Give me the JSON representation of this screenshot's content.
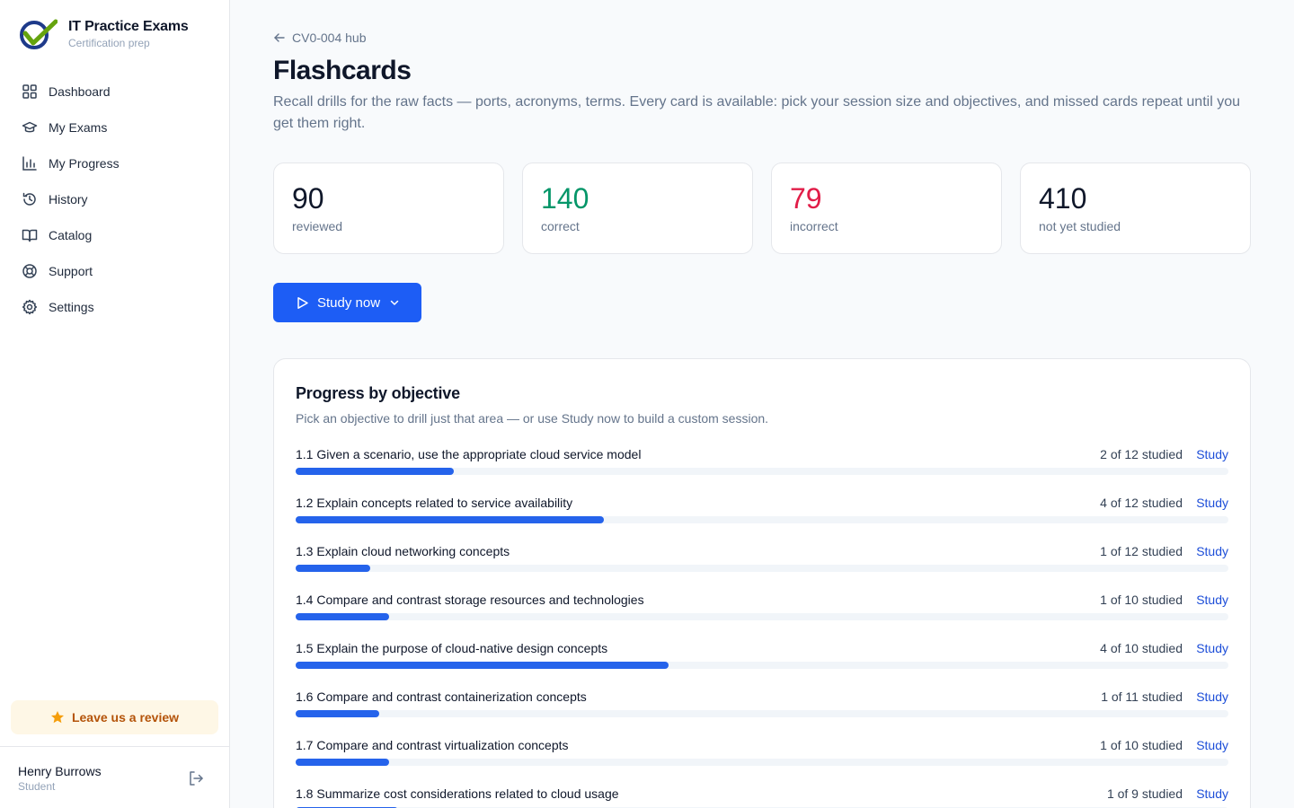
{
  "brand": {
    "title": "IT Practice Exams",
    "subtitle": "Certification prep"
  },
  "nav": [
    {
      "label": "Dashboard",
      "icon": "grid-icon"
    },
    {
      "label": "My Exams",
      "icon": "graduation-cap-icon"
    },
    {
      "label": "My Progress",
      "icon": "bar-chart-icon"
    },
    {
      "label": "History",
      "icon": "history-icon"
    },
    {
      "label": "Catalog",
      "icon": "book-open-icon"
    },
    {
      "label": "Support",
      "icon": "lifebuoy-icon"
    },
    {
      "label": "Settings",
      "icon": "gear-icon"
    }
  ],
  "review_label": "Leave us a review",
  "user": {
    "name": "Henry Burrows",
    "role": "Student"
  },
  "back_label": "CV0-004 hub",
  "page_title": "Flashcards",
  "page_desc": "Recall drills for the raw facts — ports, acronyms, terms. Every card is available: pick your session size and objectives, and missed cards repeat until you get them right.",
  "stats": [
    {
      "value": "90",
      "label": "reviewed",
      "color": "#0f172a"
    },
    {
      "value": "140",
      "label": "correct",
      "color": "#059669"
    },
    {
      "value": "79",
      "label": "incorrect",
      "color": "#e11d48"
    },
    {
      "value": "410",
      "label": "not yet studied",
      "color": "#0f172a"
    }
  ],
  "study_now_label": "Study now",
  "panel": {
    "title": "Progress by objective",
    "subtitle": "Pick an objective to drill just that area — or use Study now to build a custom session.",
    "study_label": "Study",
    "objectives": [
      {
        "label": "1.1 Given a scenario, use the appropriate cloud service model",
        "count": "2 of 12 studied",
        "progress": 0.17
      },
      {
        "label": "1.2 Explain concepts related to service availability",
        "count": "4 of 12 studied",
        "progress": 0.33
      },
      {
        "label": "1.3 Explain cloud networking concepts",
        "count": "1 of 12 studied",
        "progress": 0.08
      },
      {
        "label": "1.4 Compare and contrast storage resources and technologies",
        "count": "1 of 10 studied",
        "progress": 0.1
      },
      {
        "label": "1.5 Explain the purpose of cloud-native design concepts",
        "count": "4 of 10 studied",
        "progress": 0.4
      },
      {
        "label": "1.6 Compare and contrast containerization concepts",
        "count": "1 of 11 studied",
        "progress": 0.09
      },
      {
        "label": "1.7 Compare and contrast virtualization concepts",
        "count": "1 of 10 studied",
        "progress": 0.1
      },
      {
        "label": "1.8 Summarize cost considerations related to cloud usage",
        "count": "1 of 9 studied",
        "progress": 0.11
      }
    ]
  },
  "colors": {
    "accent": "#1d5df5",
    "review_bg": "#fef7e6",
    "review_text": "#b45309"
  }
}
